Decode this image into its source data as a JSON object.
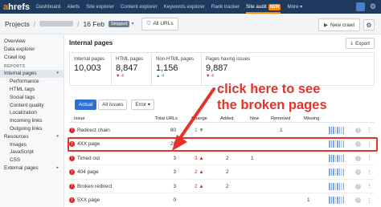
{
  "nav": {
    "logo_a": "a",
    "logo_rest": "hrefs",
    "items": [
      "Dashboard",
      "Alerts",
      "Site explorer",
      "Content explorer",
      "Keywords explorer",
      "Rank tracker",
      "Site audit",
      "More"
    ],
    "new_badge": "NEW",
    "more_caret": "▾"
  },
  "subheader": {
    "projects": "Projects",
    "sep": "/",
    "date": "16 Feb",
    "status": "Stopped",
    "all_urls": "All URLs",
    "new_crawl": "New crawl"
  },
  "sidebar": {
    "items": [
      {
        "label": "Overview"
      },
      {
        "label": "Data explorer"
      },
      {
        "label": "Crawl log"
      }
    ],
    "reports_heading": "REPORTS",
    "report_items": [
      {
        "label": "Internal pages",
        "active": true,
        "arrow": "▾"
      },
      {
        "label": "Performance",
        "child": true
      },
      {
        "label": "HTML tags",
        "child": true
      },
      {
        "label": "Social tags",
        "child": true
      },
      {
        "label": "Content quality",
        "child": true
      },
      {
        "label": "Localization",
        "child": true
      },
      {
        "label": "Incoming links",
        "child": true
      },
      {
        "label": "Outgoing links",
        "child": true
      },
      {
        "label": "Resources",
        "arrow": "▾"
      },
      {
        "label": "Images",
        "child": true
      },
      {
        "label": "JavaScript",
        "child": true
      },
      {
        "label": "CSS",
        "child": true
      },
      {
        "label": "External pages",
        "arrow": "▸"
      }
    ]
  },
  "main": {
    "title": "Internal pages",
    "export": "Export",
    "stats": [
      {
        "label": "Internal pages",
        "value": "10,003",
        "delta": "",
        "dir": ""
      },
      {
        "label": "HTML pages",
        "value": "8,847",
        "delta": "▼ 4",
        "dir": "red"
      },
      {
        "label": "Non-HTML pages",
        "value": "1,156",
        "delta": "▲ 4",
        "dir": "green"
      },
      {
        "label": "Pages having issues",
        "value": "9,887",
        "delta": "▼ 4",
        "dir": "red"
      }
    ],
    "filters": {
      "actual": "Actual",
      "all_issues": "All issues",
      "error": "Error ▾"
    },
    "columns": {
      "issue": "Issue",
      "total": "Total URLs",
      "change": "Change",
      "added": "Added",
      "new": "New",
      "removed": "Removed",
      "missing": "Missing"
    },
    "rows": [
      {
        "issue": "Redirect chain",
        "total": "80",
        "change": "1 ▼",
        "change_dir": "green",
        "added": "",
        "new": "",
        "removed": "1",
        "missing": ""
      },
      {
        "issue": "4XX page",
        "total": "20",
        "change": "",
        "change_dir": "",
        "added": "",
        "new": "",
        "removed": "",
        "missing": ""
      },
      {
        "issue": "Timed out",
        "total": "3",
        "change": "3 ▲",
        "change_dir": "red",
        "added": "2",
        "new": "1",
        "removed": "",
        "missing": ""
      },
      {
        "issue": "404 page",
        "total": "3",
        "change": "2 ▲",
        "change_dir": "red",
        "added": "2",
        "new": "",
        "removed": "",
        "missing": ""
      },
      {
        "issue": "Broken redirect",
        "total": "3",
        "change": "2 ▲",
        "change_dir": "red",
        "added": "2",
        "new": "",
        "removed": "",
        "missing": ""
      },
      {
        "issue": "5XX page",
        "total": "0",
        "change": "",
        "change_dir": "",
        "added": "",
        "new": "",
        "removed": "",
        "missing": "1"
      }
    ]
  },
  "annotation": {
    "line1": "click here to see",
    "line2": "the broken pages"
  },
  "colors": {
    "nav_bg": "#1f3a5f",
    "accent": "#ff8800",
    "annotation": "#e6332a",
    "button_blue": "#2f6fcf"
  }
}
